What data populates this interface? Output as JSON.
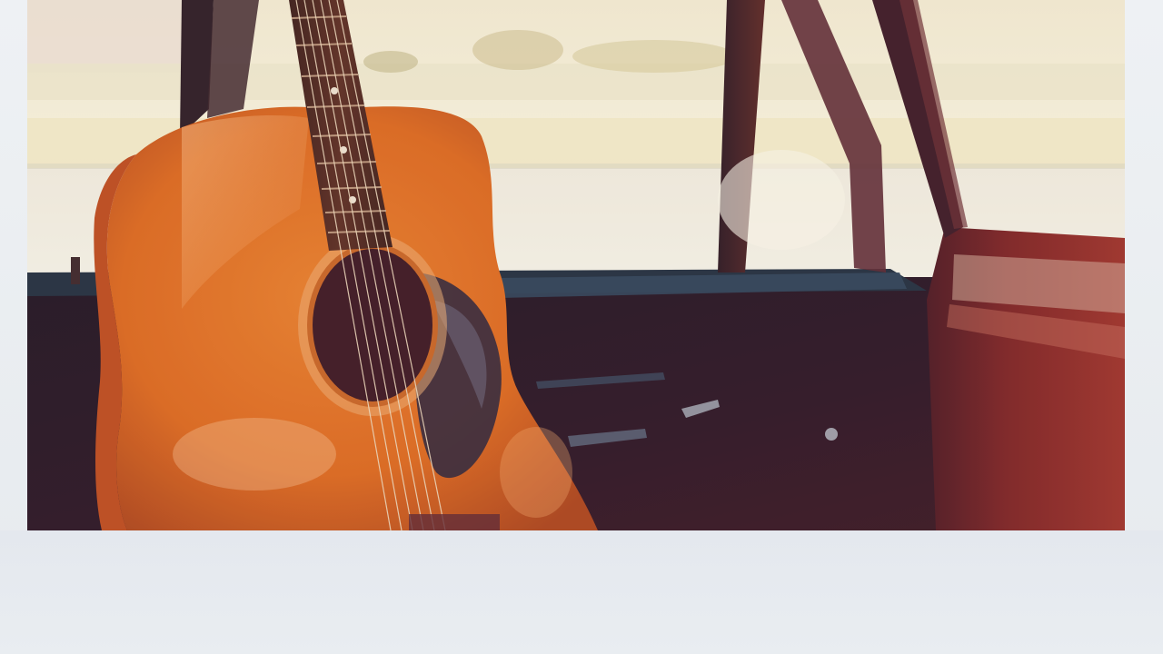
{
  "photo": {
    "subject": "",
    "colors": {
      "border": "#e9edf1",
      "guitar_body": "#d8641c",
      "guitar_highlight": "#f3a36a",
      "soundhole": "#3a1420",
      "interior_dark": "#24101e",
      "door_panel": "#7a1f22",
      "window_light": "#f4ecd2"
    }
  }
}
